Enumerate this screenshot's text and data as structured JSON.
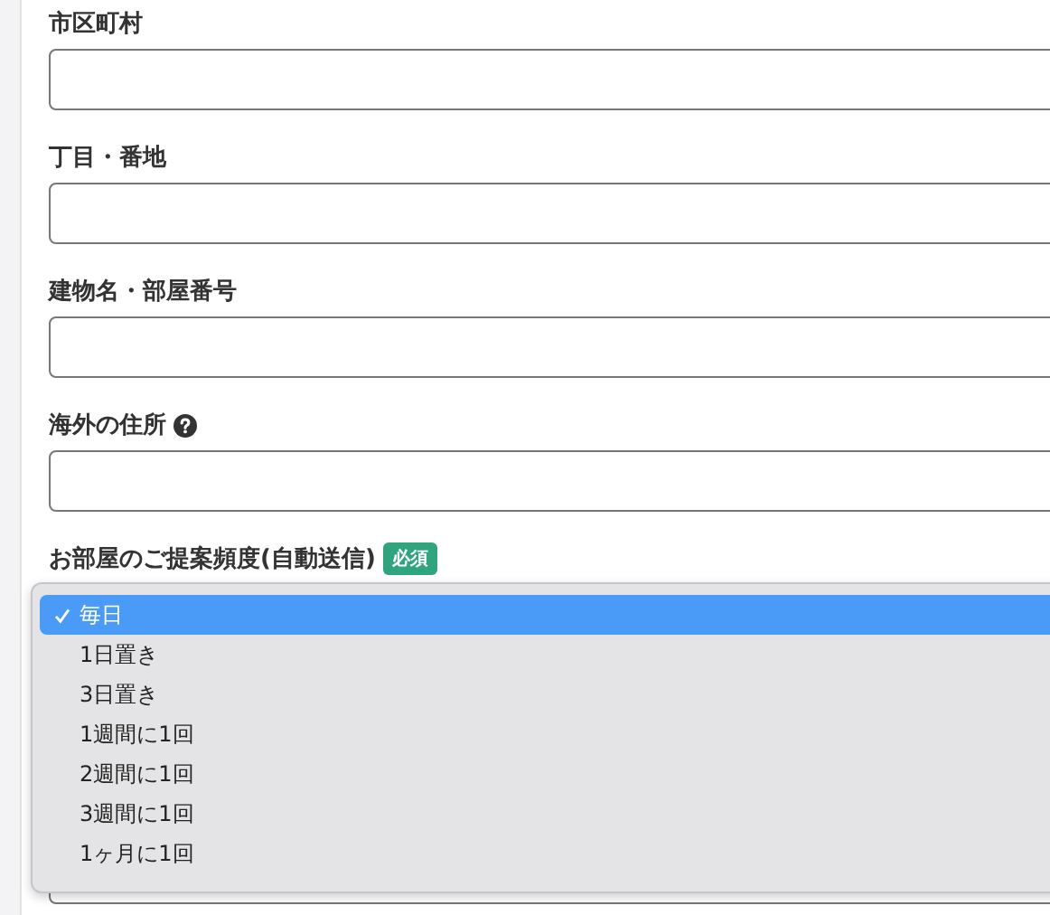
{
  "fields": [
    {
      "label": "市区町村",
      "help": false
    },
    {
      "label": "丁目・番地",
      "help": false
    },
    {
      "label": "建物名・部屋番号",
      "help": false
    },
    {
      "label": "海外の住所",
      "help": true
    }
  ],
  "frequency": {
    "label": "お部屋のご提案頻度(自動送信)",
    "badge": "必須",
    "options": [
      {
        "label": "毎日",
        "selected": true
      },
      {
        "label": "1日置き",
        "selected": false
      },
      {
        "label": "3日置き",
        "selected": false
      },
      {
        "label": "1週間に1回",
        "selected": false
      },
      {
        "label": "2週間に1回",
        "selected": false
      },
      {
        "label": "3週間に1回",
        "selected": false
      },
      {
        "label": "1ヶ月に1回",
        "selected": false
      }
    ]
  }
}
